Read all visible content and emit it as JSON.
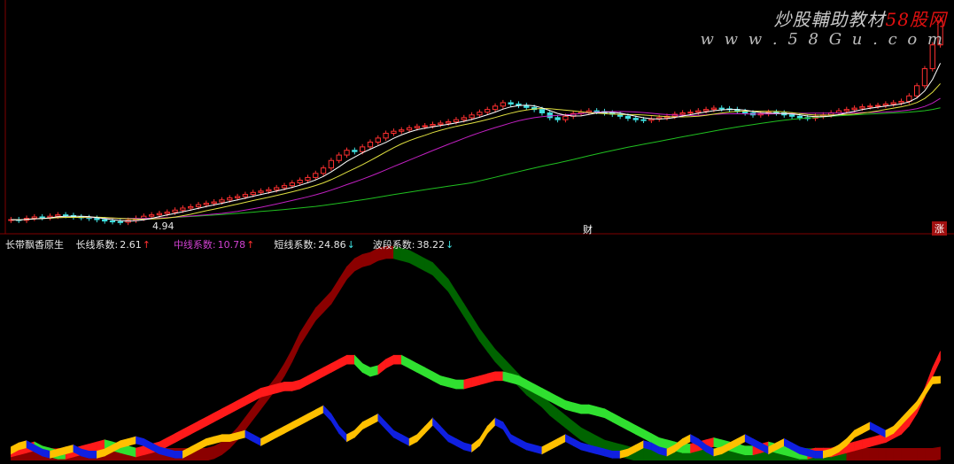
{
  "watermark": {
    "title_black": "炒股輔助教材",
    "title_red": "58股网",
    "url": "w w w . 5 8 G u . c o m"
  },
  "price_panel": {
    "low_label": "4.94",
    "marker_cai": "财",
    "marker_zhang": "涨"
  },
  "indicator_panel": {
    "name": "长带飘香原生",
    "items": [
      {
        "label": "长线系数:",
        "value": "2.61",
        "arrow": "↑",
        "color": "#e6e6e6",
        "arrow_color": "#ff3030"
      },
      {
        "label": "中线系数:",
        "value": "10.78",
        "arrow": "↑",
        "color": "#d040d0",
        "arrow_color": "#ff3030"
      },
      {
        "label": "短线系数:",
        "value": "24.86",
        "arrow": "↓",
        "color": "#e6e6e6",
        "arrow_color": "#40e0e0"
      },
      {
        "label": "波段系数:",
        "value": "38.22",
        "arrow": "↓",
        "color": "#e6e6e6",
        "arrow_color": "#40e0e0"
      }
    ]
  },
  "colors": {
    "up_candle": "#ff3030",
    "down_candle": "#40e0e0",
    "ma_short": "#ffffff",
    "ma_mid": "#e0e040",
    "ma_purple": "#c020c0",
    "ma_long": "#20c020",
    "long_band_up": "#8b0000",
    "long_band_down": "#006400",
    "mid_band_up": "#ff1a1a",
    "mid_band_down": "#30e030",
    "short_band_up": "#ffc000",
    "short_band_down": "#1020e0",
    "divider": "#800000"
  },
  "chart_data": {
    "type": "line",
    "price": {
      "n": 120,
      "close": [
        4.98,
        4.97,
        5.0,
        5.02,
        5.01,
        5.03,
        5.05,
        5.04,
        5.02,
        5.01,
        5.0,
        4.98,
        4.96,
        4.95,
        4.94,
        4.97,
        5.0,
        5.03,
        5.05,
        5.07,
        5.09,
        5.12,
        5.15,
        5.17,
        5.2,
        5.22,
        5.24,
        5.27,
        5.3,
        5.32,
        5.35,
        5.38,
        5.4,
        5.42,
        5.45,
        5.48,
        5.52,
        5.56,
        5.6,
        5.66,
        5.74,
        5.85,
        5.93,
        6.0,
        5.98,
        6.05,
        6.12,
        6.18,
        6.25,
        6.28,
        6.3,
        6.33,
        6.35,
        6.36,
        6.38,
        6.4,
        6.42,
        6.45,
        6.48,
        6.52,
        6.56,
        6.6,
        6.65,
        6.7,
        6.68,
        6.66,
        6.63,
        6.6,
        6.55,
        6.48,
        6.45,
        6.5,
        6.54,
        6.56,
        6.58,
        6.57,
        6.55,
        6.53,
        6.5,
        6.47,
        6.45,
        6.44,
        6.46,
        6.48,
        6.5,
        6.53,
        6.55,
        6.56,
        6.58,
        6.6,
        6.62,
        6.61,
        6.6,
        6.57,
        6.55,
        6.52,
        6.54,
        6.56,
        6.55,
        6.52,
        6.5,
        6.48,
        6.47,
        6.5,
        6.52,
        6.55,
        6.58,
        6.6,
        6.62,
        6.64,
        6.65,
        6.66,
        6.68,
        6.7,
        6.72,
        6.8,
        6.95,
        7.2,
        7.55,
        7.9
      ],
      "ylim": [
        4.85,
        7.95
      ]
    },
    "indicator": {
      "ylim": [
        0,
        100
      ],
      "long": [
        2,
        2,
        2,
        2,
        2,
        2,
        2,
        2,
        2,
        2,
        2,
        2,
        2,
        2,
        2,
        2,
        2,
        2,
        2,
        2,
        2,
        2,
        2,
        2,
        2,
        2,
        3,
        5,
        8,
        12,
        17,
        22,
        27,
        32,
        37,
        43,
        50,
        58,
        64,
        70,
        74,
        78,
        84,
        90,
        94,
        96,
        97,
        99,
        100,
        100,
        99,
        98,
        96,
        94,
        92,
        88,
        84,
        78,
        72,
        66,
        60,
        55,
        50,
        46,
        42,
        38,
        34,
        31,
        28,
        24,
        21,
        18,
        15,
        12,
        10,
        8,
        6,
        5,
        4,
        3,
        2,
        2,
        2,
        2,
        2,
        2,
        2,
        2,
        2,
        2,
        2,
        2,
        2,
        2,
        2,
        2,
        2,
        2,
        2,
        2,
        2,
        2,
        2,
        2,
        2,
        2,
        2,
        2,
        2,
        2,
        2,
        2,
        2,
        2,
        2,
        2,
        2,
        2,
        2,
        2.61
      ],
      "long_dir": [
        1,
        1,
        1,
        1,
        1,
        1,
        1,
        1,
        1,
        1,
        1,
        1,
        1,
        1,
        1,
        1,
        1,
        1,
        1,
        1,
        1,
        1,
        1,
        1,
        1,
        1,
        1,
        1,
        1,
        1,
        1,
        1,
        1,
        1,
        1,
        1,
        1,
        1,
        1,
        1,
        1,
        1,
        1,
        1,
        1,
        1,
        1,
        1,
        1,
        1,
        -1,
        -1,
        -1,
        -1,
        -1,
        -1,
        -1,
        -1,
        -1,
        -1,
        -1,
        -1,
        -1,
        -1,
        -1,
        -1,
        -1,
        -1,
        -1,
        -1,
        -1,
        -1,
        -1,
        -1,
        -1,
        -1,
        -1,
        -1,
        -1,
        -1,
        -1,
        -1,
        -1,
        -1,
        -1,
        -1,
        -1,
        -1,
        -1,
        -1,
        -1,
        -1,
        -1,
        -1,
        -1,
        -1,
        -1,
        -1,
        -1,
        -1,
        -1,
        -1,
        -1,
        -1,
        -1,
        -1,
        -1,
        -1,
        1,
        1,
        1,
        1,
        1,
        1,
        1,
        1,
        1,
        1,
        1,
        1
      ],
      "mid": [
        3,
        4,
        5,
        6,
        4,
        3,
        2,
        2,
        3,
        4,
        5,
        6,
        7,
        6,
        5,
        4,
        3,
        4,
        5,
        6,
        8,
        10,
        12,
        14,
        16,
        18,
        20,
        22,
        24,
        26,
        28,
        30,
        32,
        33,
        34,
        35,
        35,
        36,
        38,
        40,
        42,
        44,
        46,
        48,
        48,
        44,
        42,
        43,
        46,
        48,
        48,
        46,
        44,
        42,
        40,
        38,
        37,
        36,
        36,
        37,
        38,
        39,
        40,
        40,
        39,
        38,
        36,
        34,
        32,
        30,
        28,
        26,
        25,
        24,
        24,
        23,
        22,
        20,
        18,
        16,
        14,
        12,
        10,
        8,
        7,
        6,
        5,
        5,
        6,
        7,
        8,
        7,
        6,
        5,
        4,
        4,
        5,
        6,
        5,
        4,
        3,
        2,
        2,
        3,
        3,
        3,
        4,
        5,
        6,
        7,
        8,
        9,
        10,
        12,
        14,
        18,
        24,
        32,
        42,
        50
      ],
      "mid_dir": [
        1,
        1,
        1,
        1,
        -1,
        -1,
        -1,
        -1,
        1,
        1,
        1,
        1,
        1,
        -1,
        -1,
        -1,
        -1,
        1,
        1,
        1,
        1,
        1,
        1,
        1,
        1,
        1,
        1,
        1,
        1,
        1,
        1,
        1,
        1,
        1,
        1,
        1,
        1,
        1,
        1,
        1,
        1,
        1,
        1,
        1,
        1,
        -1,
        -1,
        -1,
        1,
        1,
        1,
        -1,
        -1,
        -1,
        -1,
        -1,
        -1,
        -1,
        -1,
        1,
        1,
        1,
        1,
        1,
        -1,
        -1,
        -1,
        -1,
        -1,
        -1,
        -1,
        -1,
        -1,
        -1,
        -1,
        -1,
        -1,
        -1,
        -1,
        -1,
        -1,
        -1,
        -1,
        -1,
        -1,
        -1,
        -1,
        -1,
        1,
        1,
        1,
        -1,
        -1,
        -1,
        -1,
        -1,
        1,
        1,
        -1,
        -1,
        -1,
        -1,
        -1,
        1,
        1,
        1,
        1,
        1,
        1,
        1,
        1,
        1,
        1,
        1,
        1,
        1,
        1,
        1,
        1,
        1
      ],
      "short": [
        4,
        6,
        7,
        5,
        3,
        2,
        3,
        4,
        5,
        3,
        2,
        2,
        3,
        5,
        7,
        8,
        9,
        8,
        6,
        4,
        3,
        2,
        2,
        4,
        6,
        8,
        9,
        10,
        10,
        11,
        12,
        10,
        8,
        10,
        12,
        14,
        16,
        18,
        20,
        22,
        24,
        20,
        14,
        10,
        12,
        16,
        18,
        20,
        16,
        12,
        10,
        8,
        10,
        14,
        18,
        14,
        10,
        8,
        6,
        5,
        8,
        14,
        18,
        16,
        10,
        8,
        6,
        5,
        4,
        6,
        8,
        10,
        8,
        6,
        5,
        4,
        3,
        2,
        2,
        3,
        5,
        7,
        6,
        4,
        3,
        5,
        8,
        10,
        8,
        5,
        3,
        4,
        6,
        8,
        10,
        8,
        6,
        4,
        6,
        8,
        6,
        4,
        3,
        2,
        2,
        3,
        5,
        8,
        12,
        14,
        16,
        14,
        12,
        14,
        18,
        22,
        26,
        32,
        38,
        38.22
      ],
      "short_dir": [
        1,
        1,
        1,
        -1,
        -1,
        -1,
        1,
        1,
        1,
        -1,
        -1,
        -1,
        1,
        1,
        1,
        1,
        1,
        -1,
        -1,
        -1,
        -1,
        -1,
        -1,
        1,
        1,
        1,
        1,
        1,
        1,
        1,
        1,
        -1,
        -1,
        1,
        1,
        1,
        1,
        1,
        1,
        1,
        1,
        -1,
        -1,
        -1,
        1,
        1,
        1,
        1,
        -1,
        -1,
        -1,
        -1,
        1,
        1,
        1,
        -1,
        -1,
        -1,
        -1,
        -1,
        1,
        1,
        1,
        -1,
        -1,
        -1,
        -1,
        -1,
        -1,
        1,
        1,
        1,
        -1,
        -1,
        -1,
        -1,
        -1,
        -1,
        -1,
        1,
        1,
        1,
        -1,
        -1,
        -1,
        1,
        1,
        1,
        -1,
        -1,
        -1,
        1,
        1,
        1,
        1,
        -1,
        -1,
        -1,
        1,
        1,
        -1,
        -1,
        -1,
        -1,
        -1,
        1,
        1,
        1,
        1,
        1,
        1,
        -1,
        -1,
        1,
        1,
        1,
        1,
        1,
        1,
        1
      ]
    }
  }
}
